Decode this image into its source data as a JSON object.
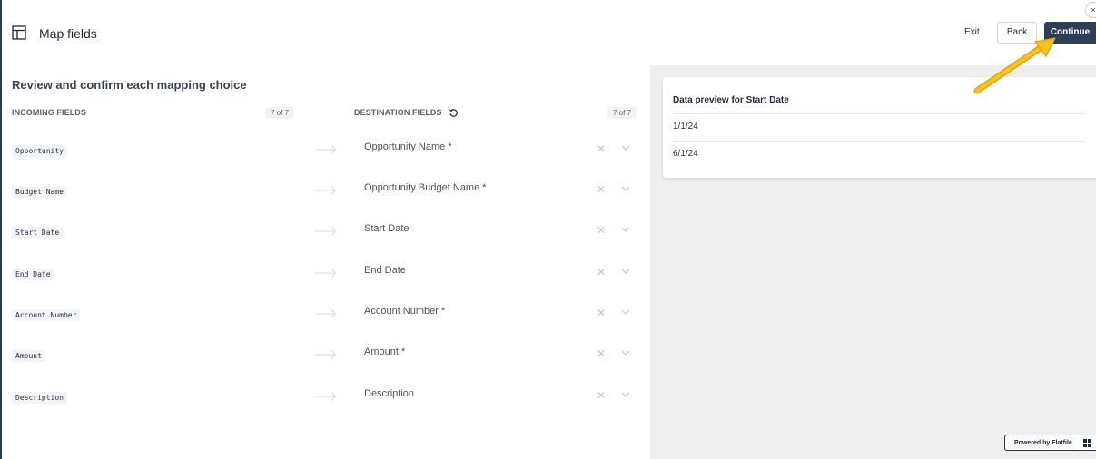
{
  "header": {
    "title": "Map fields",
    "exit_label": "Exit",
    "back_label": "Back",
    "continue_label": "Continue",
    "close_symbol": "×"
  },
  "mapping": {
    "heading": "Review and confirm each mapping choice",
    "incoming_header": "INCOMING FIELDS",
    "incoming_count": "7 of 7",
    "destination_header": "DESTINATION FIELDS",
    "destination_count": "7 of 7",
    "rows": [
      {
        "incoming": "Opportunity",
        "destination": "Opportunity Name *"
      },
      {
        "incoming": "Budget Name",
        "destination": "Opportunity Budget Name *"
      },
      {
        "incoming": "Start Date",
        "destination": "Start Date"
      },
      {
        "incoming": "End Date",
        "destination": "End Date"
      },
      {
        "incoming": "Account Number",
        "destination": "Account Number *"
      },
      {
        "incoming": "Amount",
        "destination": "Amount *"
      },
      {
        "incoming": "Description",
        "destination": "Description"
      }
    ]
  },
  "preview": {
    "title": "Data preview for Start Date",
    "values": [
      "1/1/24",
      "6/1/24"
    ]
  },
  "footer": {
    "powered_by": "Powered by Flatfile"
  },
  "icons": {
    "table": "table-icon",
    "reset": "reset-icon",
    "arrow": "arrow-right-icon",
    "clear": "close-icon",
    "chevron": "chevron-down-icon",
    "annotation": "annotation-arrow-icon"
  },
  "colors": {
    "primary": "#2f3d55",
    "panel_bg": "#efefef",
    "annotation": "#f5b400"
  }
}
